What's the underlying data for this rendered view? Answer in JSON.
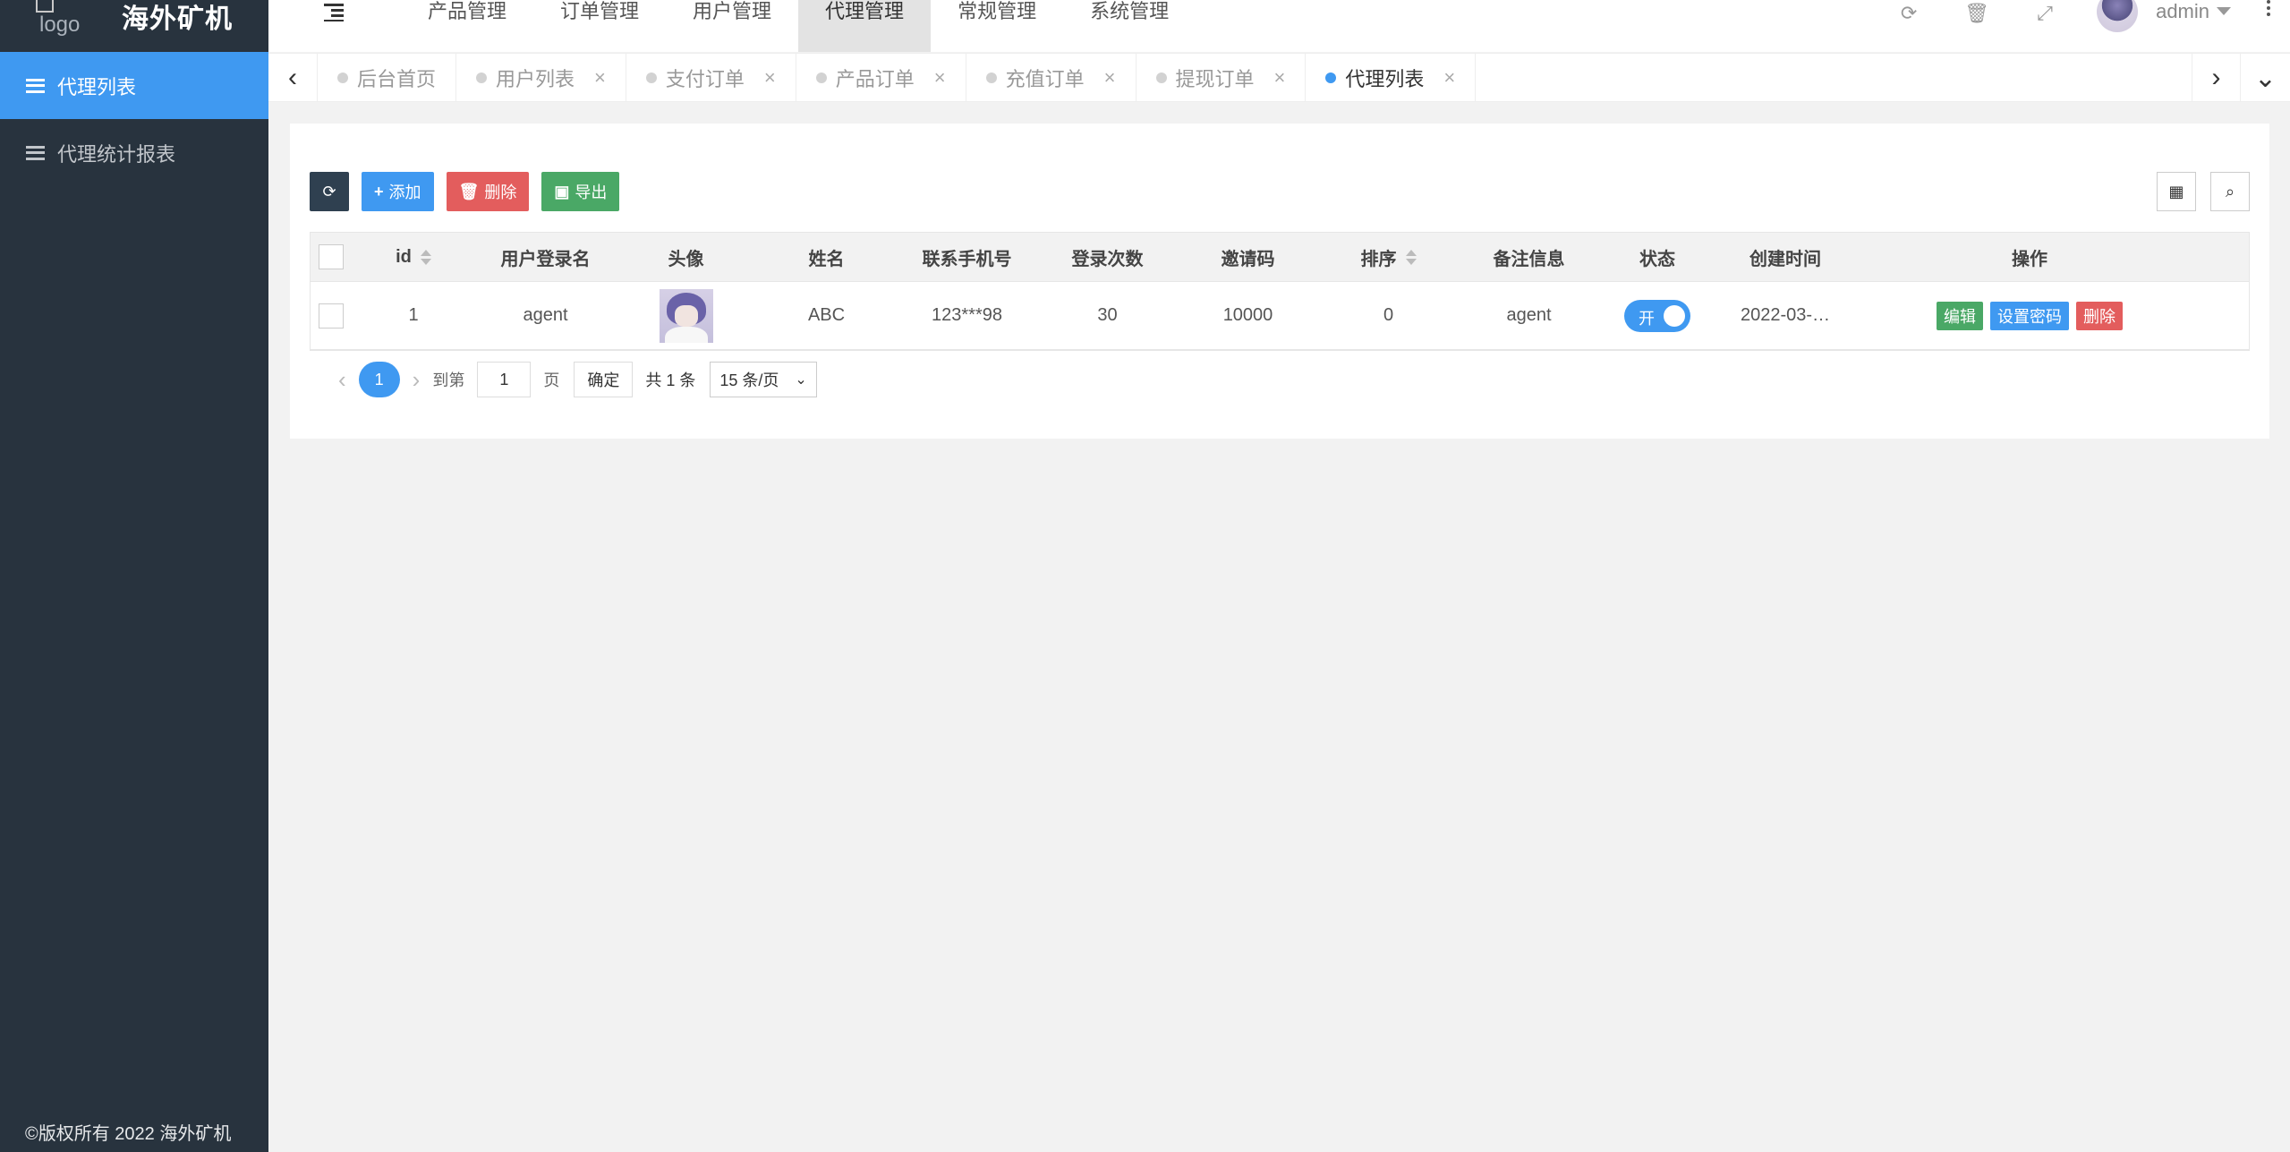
{
  "app": {
    "logo_alt": "logo",
    "brand": "海外矿机",
    "footer": "©版权所有 2022 海外矿机"
  },
  "sidebar": {
    "items": [
      {
        "label": "代理列表",
        "active": true
      },
      {
        "label": "代理统计报表",
        "active": false
      }
    ]
  },
  "header": {
    "nav": [
      "产品管理",
      "订单管理",
      "用户管理",
      "代理管理",
      "常规管理",
      "系统管理"
    ],
    "active_nav": "代理管理",
    "user": "admin"
  },
  "tabs": [
    {
      "label": "后台首页",
      "closable": false
    },
    {
      "label": "用户列表",
      "closable": true
    },
    {
      "label": "支付订单",
      "closable": true
    },
    {
      "label": "产品订单",
      "closable": true
    },
    {
      "label": "充值订单",
      "closable": true
    },
    {
      "label": "提现订单",
      "closable": true
    },
    {
      "label": "代理列表",
      "closable": true,
      "active": true
    }
  ],
  "toolbar": {
    "add": "添加",
    "delete": "删除",
    "export": "导出"
  },
  "table": {
    "columns": [
      "id",
      "用户登录名",
      "头像",
      "姓名",
      "联系手机号",
      "登录次数",
      "邀请码",
      "排序",
      "备注信息",
      "状态",
      "创建时间",
      "操作"
    ],
    "rows": [
      {
        "id": "1",
        "username": "agent",
        "name": "ABC",
        "phone": "123***98",
        "login_count": "30",
        "invite_code": "10000",
        "sort": "0",
        "remark": "agent",
        "status_label": "开",
        "created": "2022-03-…",
        "ops": [
          "编辑",
          "设置密码",
          "删除"
        ]
      }
    ]
  },
  "pager": {
    "current": "1",
    "goto_label": "到第",
    "goto_value": "1",
    "page_label": "页",
    "confirm": "确定",
    "total": "共 1 条",
    "size": "15 条/页"
  },
  "colors": {
    "accent": "#3f99f1",
    "sidebar": "#28333e",
    "danger": "#e35d5d",
    "success": "#4aa866"
  }
}
